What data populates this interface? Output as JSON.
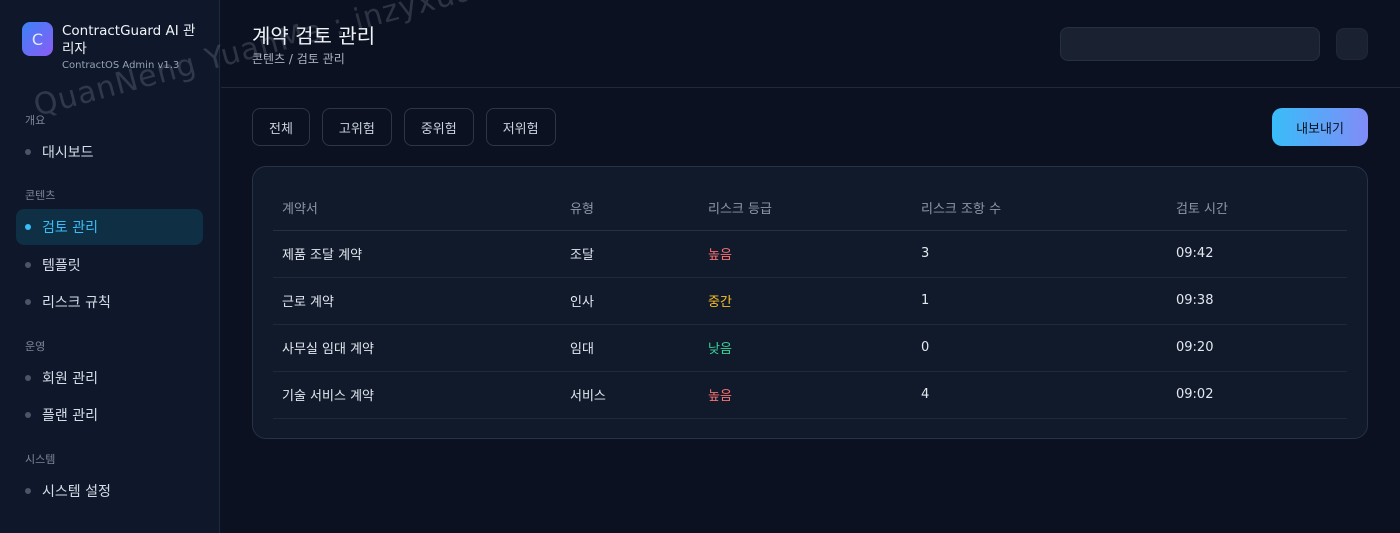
{
  "brand": {
    "logo_letter": "C",
    "title": "ContractGuard AI 관리자",
    "subtitle": "ContractOS Admin v1.3"
  },
  "sidebar": {
    "sections": [
      {
        "label": "개요",
        "items": [
          {
            "label": "대시보드",
            "active": false
          }
        ]
      },
      {
        "label": "콘텐츠",
        "items": [
          {
            "label": "검토 관리",
            "active": true
          },
          {
            "label": "템플릿",
            "active": false
          },
          {
            "label": "리스크 규칙",
            "active": false
          }
        ]
      },
      {
        "label": "운영",
        "items": [
          {
            "label": "회원 관리",
            "active": false
          },
          {
            "label": "플랜 관리",
            "active": false
          }
        ]
      },
      {
        "label": "시스템",
        "items": [
          {
            "label": "시스템 설정",
            "active": false
          }
        ]
      }
    ]
  },
  "header": {
    "title": "계약 검토 관리",
    "breadcrumb": "콘텐츠 / 검토 관리"
  },
  "filters": [
    "전체",
    "고위험",
    "중위험",
    "저위험"
  ],
  "export_label": "내보내기",
  "table": {
    "columns": [
      "계약서",
      "유형",
      "리스크 등급",
      "리스크 조항 수",
      "검토 시간"
    ],
    "rows": [
      {
        "name": "제품 조달 계약",
        "type": "조달",
        "risk": "높음",
        "risk_level": "high",
        "clauses": "3",
        "time": "09:42"
      },
      {
        "name": "근로 계약",
        "type": "인사",
        "risk": "중간",
        "risk_level": "mid",
        "clauses": "1",
        "time": "09:38"
      },
      {
        "name": "사무실 임대 계약",
        "type": "임대",
        "risk": "낮음",
        "risk_level": "low",
        "clauses": "0",
        "time": "09:20"
      },
      {
        "name": "기술 서비스 계약",
        "type": "서비스",
        "risk": "높음",
        "risk_level": "high",
        "clauses": "4",
        "time": "09:02"
      }
    ]
  },
  "colors": {
    "risk_high": "#f87171",
    "risk_mid": "#fbbf24",
    "risk_low": "#34d399",
    "accent": "#38bdf8"
  },
  "watermark": "QuanNeng YuanMa : inzyxuashop.com"
}
